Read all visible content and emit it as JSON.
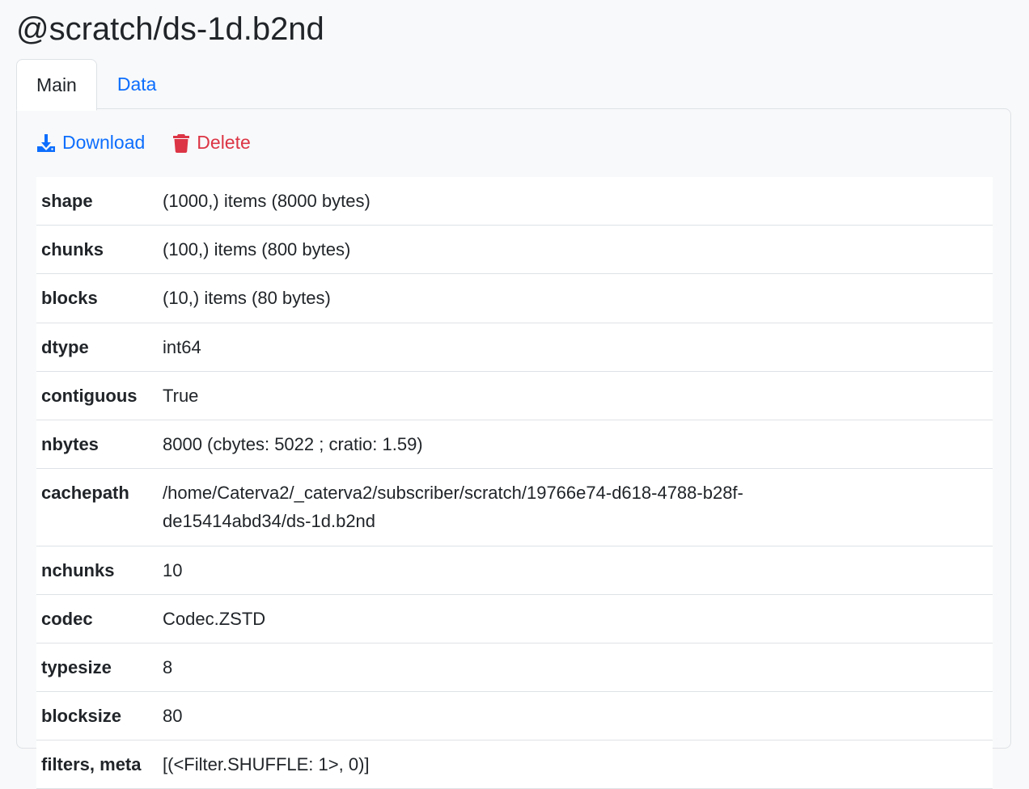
{
  "title": "@scratch/ds-1d.b2nd",
  "tabs": [
    {
      "label": "Main",
      "active": true
    },
    {
      "label": "Data",
      "active": false
    }
  ],
  "actions": {
    "download_label": "Download",
    "delete_label": "Delete",
    "download_icon": "download-icon",
    "delete_icon": "trash-icon"
  },
  "colors": {
    "link": "#0d6efd",
    "danger": "#dc3545"
  },
  "table": {
    "rows": [
      {
        "key": "shape",
        "value": "(1000,) items (8000 bytes)"
      },
      {
        "key": "chunks",
        "value": "(100,) items (800 bytes)"
      },
      {
        "key": "blocks",
        "value": "(10,) items (80 bytes)"
      },
      {
        "key": "dtype",
        "value": "int64"
      },
      {
        "key": "contiguous",
        "value": "True"
      },
      {
        "key": "nbytes",
        "value": "8000 (cbytes: 5022 ; cratio: 1.59)"
      },
      {
        "key": "cachepath",
        "value": "/home/Caterva2/_caterva2/subscriber/scratch/19766e74-d618-4788-b28f-de15414abd34/ds-1d.b2nd"
      },
      {
        "key": "nchunks",
        "value": "10"
      },
      {
        "key": "codec",
        "value": "Codec.ZSTD"
      },
      {
        "key": "typesize",
        "value": "8"
      },
      {
        "key": "blocksize",
        "value": "80"
      },
      {
        "key": "filters, meta",
        "value": "[(<Filter.SHUFFLE: 1>, 0)]"
      }
    ]
  }
}
